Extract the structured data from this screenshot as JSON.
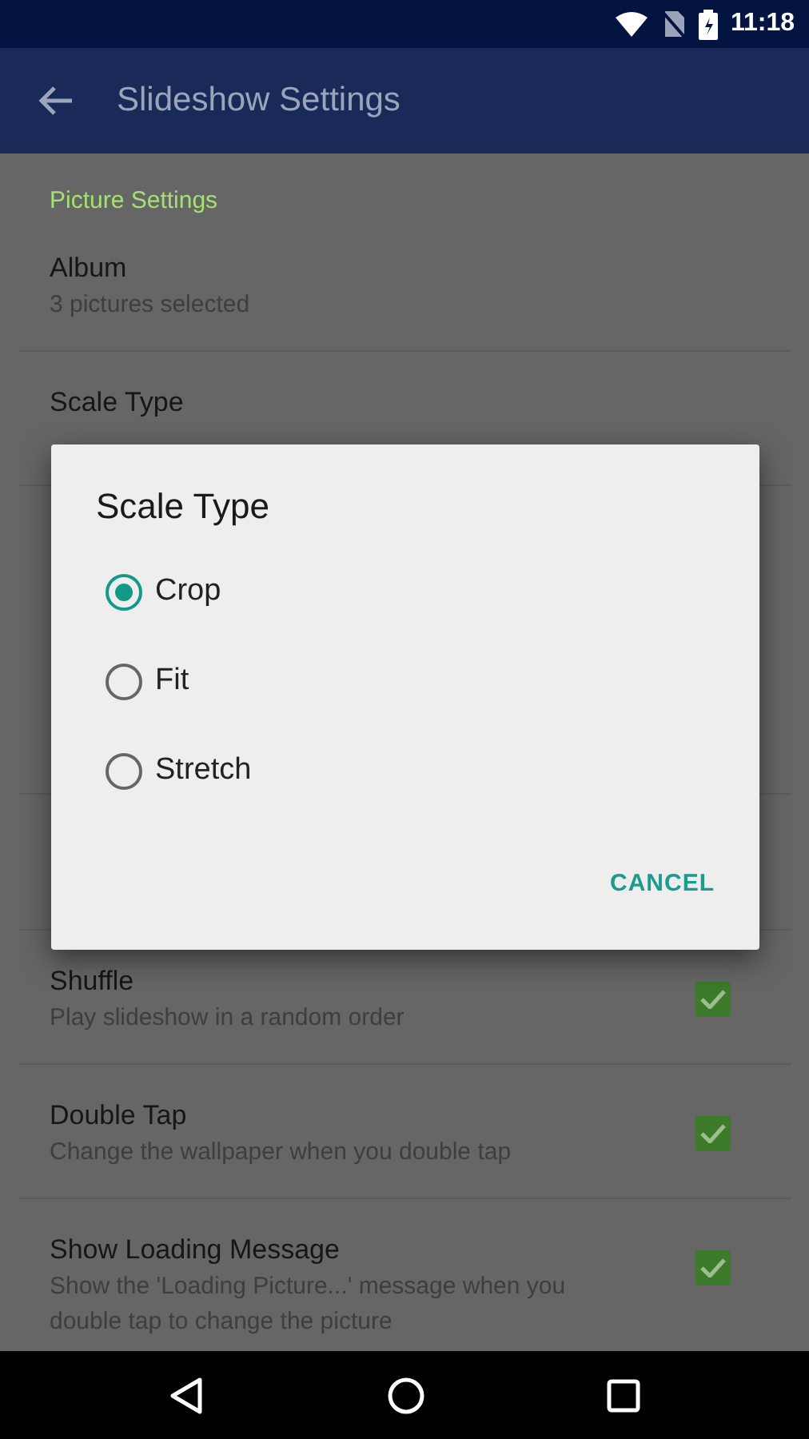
{
  "status_bar": {
    "time": "11:18"
  },
  "app_bar": {
    "title": "Slideshow Settings"
  },
  "settings_above": [
    {
      "kind": "header",
      "title": "Picture Settings"
    },
    {
      "kind": "item",
      "title": "Album",
      "summary": "3 pictures selected"
    },
    {
      "kind": "item",
      "title": "Scale Type"
    }
  ],
  "settings_below": [
    {
      "kind": "checkbox",
      "title": "Shuffle",
      "summary": "Play slideshow in a random order",
      "checked": true
    },
    {
      "kind": "checkbox",
      "title": "Double Tap",
      "summary": "Change the wallpaper when you double tap",
      "checked": true
    },
    {
      "kind": "checkbox",
      "title": "Show Loading Message",
      "summary": "Show the 'Loading Picture...' message when you double tap to change the picture",
      "checked": true
    }
  ],
  "dialog": {
    "title": "Scale Type",
    "options": [
      {
        "label": "Crop",
        "selected": true
      },
      {
        "label": "Fit",
        "selected": false
      },
      {
        "label": "Stretch",
        "selected": false
      }
    ],
    "buttons": [
      "CANCEL"
    ]
  }
}
